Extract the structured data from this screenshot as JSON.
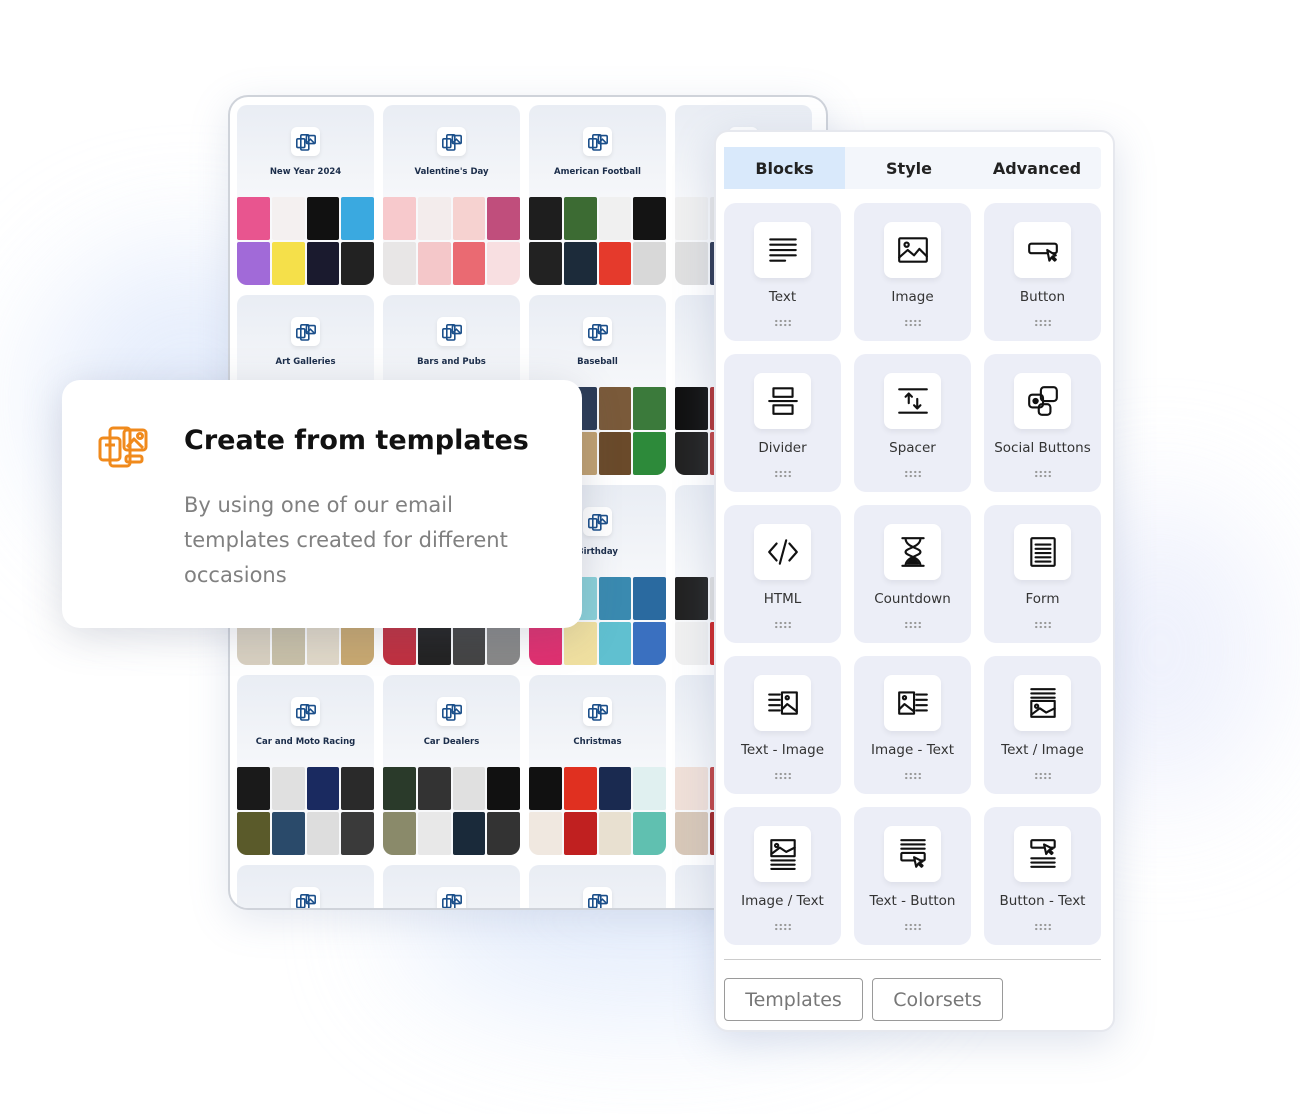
{
  "templates": [
    {
      "label": "New Year 2024",
      "thumbs": [
        "#e8558f",
        "#f4f0f0",
        "#111111",
        "#3aa9e0",
        "#a16ad8",
        "#f5e04a",
        "#1a1a2e",
        "#222222"
      ]
    },
    {
      "label": "Valentine's Day",
      "thumbs": [
        "#f7c9cc",
        "#f3ecec",
        "#f6d2d0",
        "#c04e7c",
        "#e8e6e6",
        "#f4c7c9",
        "#ea6a72",
        "#f8dfe1"
      ]
    },
    {
      "label": "American Football",
      "thumbs": [
        "#1e1e1e",
        "#3c6b33",
        "#f0f0f0",
        "#141414",
        "#222222",
        "#1c2b3a",
        "#e53a2c",
        "#d8d8d8"
      ]
    },
    {
      "label": "",
      "thumbs": [
        "#f0f0f0",
        "#e8e8e8",
        "#dddddd",
        "#8a9ad0",
        "#e0e0e0",
        "#2a3550",
        "#cccccc",
        "#dddddd"
      ]
    },
    {
      "label": "Art Galleries",
      "thumbs": []
    },
    {
      "label": "Bars and Pubs",
      "thumbs": []
    },
    {
      "label": "Baseball",
      "thumbs": [
        "#1a1a1a",
        "#2a3a55",
        "#7a5a3a",
        "#3b7a3b",
        "#111111",
        "#c0a070",
        "#6a4a2a",
        "#2d8a3a"
      ]
    },
    {
      "label": "",
      "thumbs": [
        "#111111",
        "#b03030",
        "#222222",
        "#a03030",
        "#222222",
        "#c04040",
        "#333333",
        "#b03a3a"
      ]
    },
    {
      "label": "",
      "thumbs": [
        "#e8e0d0",
        "#d4c8a0",
        "#cfcfcf",
        "#e0c080",
        "#d8d0c0",
        "#c8c0a8",
        "#e0d8c8",
        "#c8a870"
      ]
    },
    {
      "label": "",
      "thumbs": [
        "#cc2030",
        "#111111",
        "#333333",
        "#555555",
        "#c03040",
        "#222222",
        "#444444",
        "#888888"
      ]
    },
    {
      "label": "Birthday",
      "thumbs": [
        "#f0a040",
        "#8ad0d8",
        "#3a8ab0",
        "#2a6aa0",
        "#e03070",
        "#f0e0a0",
        "#60c0d0",
        "#3a70c0"
      ]
    },
    {
      "label": "",
      "thumbs": [
        "#222222",
        "#e0e0e0",
        "#ffffff",
        "#111111",
        "#f0f0f0",
        "#cc2222",
        "#e8e8e8",
        "#dddddd"
      ]
    },
    {
      "label": "Car and Moto Racing",
      "thumbs": [
        "#1a1a1a",
        "#e0e0e0",
        "#1a2a60",
        "#2a2a2a",
        "#5a5a2a",
        "#2a4a6a",
        "#ddd",
        "#3a3a3a"
      ]
    },
    {
      "label": "Car Dealers",
      "thumbs": [
        "#2a3a2a",
        "#333333",
        "#e0e0e0",
        "#111111",
        "#8a8a6a",
        "#e8e8e8",
        "#1a2a3a",
        "#333333"
      ]
    },
    {
      "label": "Christmas",
      "thumbs": [
        "#111111",
        "#e03020",
        "#1a2a50",
        "#e0f0f0",
        "#f0e8e0",
        "#c02020",
        "#e8e0d0",
        "#60c0b0"
      ]
    },
    {
      "label": "",
      "thumbs": [
        "#f0e0d8",
        "#c04040",
        "#6a3a3a",
        "#222222",
        "#d8c8b8",
        "#a02020",
        "#553333",
        "#333333"
      ]
    },
    {
      "label": "",
      "thumbs": []
    },
    {
      "label": "",
      "thumbs": []
    },
    {
      "label": "",
      "thumbs": []
    },
    {
      "label": "",
      "thumbs": []
    }
  ],
  "panel": {
    "tabs": [
      "Blocks",
      "Style",
      "Advanced"
    ],
    "active_tab": "Blocks",
    "blocks": [
      {
        "label": "Text",
        "icon": "text-lines-icon"
      },
      {
        "label": "Image",
        "icon": "image-icon"
      },
      {
        "label": "Button",
        "icon": "button-cursor-icon"
      },
      {
        "label": "Divider",
        "icon": "divider-icon"
      },
      {
        "label": "Spacer",
        "icon": "spacer-icon"
      },
      {
        "label": "Social Buttons",
        "icon": "social-buttons-icon"
      },
      {
        "label": "HTML",
        "icon": "code-icon"
      },
      {
        "label": "Countdown",
        "icon": "hourglass-icon"
      },
      {
        "label": "Form",
        "icon": "form-icon"
      },
      {
        "label": "Text - Image",
        "icon": "text-image-icon"
      },
      {
        "label": "Image - Text",
        "icon": "image-text-icon"
      },
      {
        "label": "Text / Image",
        "icon": "text-over-image-icon"
      },
      {
        "label": "Image / Text",
        "icon": "image-over-text-icon"
      },
      {
        "label": "Text - Button",
        "icon": "text-button-icon"
      },
      {
        "label": "Button - Text",
        "icon": "button-text-icon"
      }
    ],
    "templates_button": "Templates",
    "colorsets_button": "Colorsets"
  },
  "callout": {
    "title": "Create from templates",
    "description": "By using one of our email templates created for different occasions",
    "icon": "templates-icon",
    "accent": "#f08a1c"
  }
}
